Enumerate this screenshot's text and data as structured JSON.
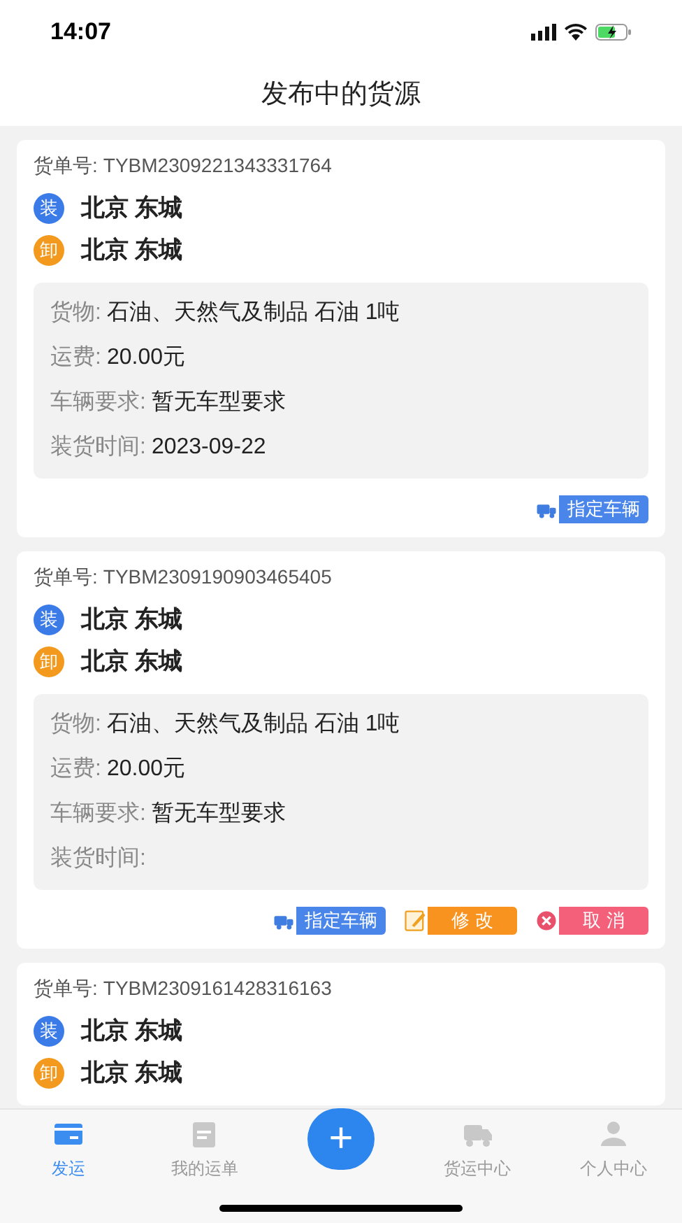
{
  "status_bar": {
    "time": "14:07"
  },
  "header": {
    "title": "发布中的货源"
  },
  "orders": [
    {
      "order_label": "货单号:",
      "order_no": "TYBM2309221343331764",
      "stops": [
        {
          "kind": "load",
          "badge": "装",
          "place": "北京 东城"
        },
        {
          "kind": "unload",
          "badge": "卸",
          "place": "北京 东城"
        }
      ],
      "details": [
        {
          "label": "货物:",
          "value": "石油、天然气及制品 石油 1吨"
        },
        {
          "label": "运费:",
          "value": "20.00元"
        },
        {
          "label": "车辆要求:",
          "value": "暂无车型要求"
        },
        {
          "label": "装货时间:",
          "value": "2023-09-22"
        }
      ],
      "actions": [
        {
          "kind": "assign",
          "label": "指定车辆"
        }
      ]
    },
    {
      "order_label": "货单号:",
      "order_no": "TYBM2309190903465405",
      "stops": [
        {
          "kind": "load",
          "badge": "装",
          "place": "北京 东城"
        },
        {
          "kind": "unload",
          "badge": "卸",
          "place": "北京 东城"
        }
      ],
      "details": [
        {
          "label": "货物:",
          "value": "石油、天然气及制品 石油 1吨"
        },
        {
          "label": "运费:",
          "value": "20.00元"
        },
        {
          "label": "车辆要求:",
          "value": "暂无车型要求"
        },
        {
          "label": "装货时间:"
        }
      ],
      "actions": [
        {
          "kind": "assign",
          "label": "指定车辆"
        },
        {
          "kind": "edit",
          "label": "修 改"
        },
        {
          "kind": "cancel",
          "label": "取 消"
        }
      ]
    },
    {
      "order_label": "货单号:",
      "order_no": "TYBM2309161428316163",
      "stops": [
        {
          "kind": "load",
          "badge": "装",
          "place": "北京 东城"
        },
        {
          "kind": "unload",
          "badge": "卸",
          "place": "北京 东城"
        }
      ]
    }
  ],
  "tab_bar": [
    {
      "kind": "ship",
      "label": "发运",
      "selected": true
    },
    {
      "kind": "waybill",
      "label": "我的运单",
      "selected": false
    },
    {
      "kind": "add",
      "label": "+"
    },
    {
      "kind": "freight",
      "label": "货运中心",
      "selected": false
    },
    {
      "kind": "profile",
      "label": "个人中心",
      "selected": false
    }
  ]
}
